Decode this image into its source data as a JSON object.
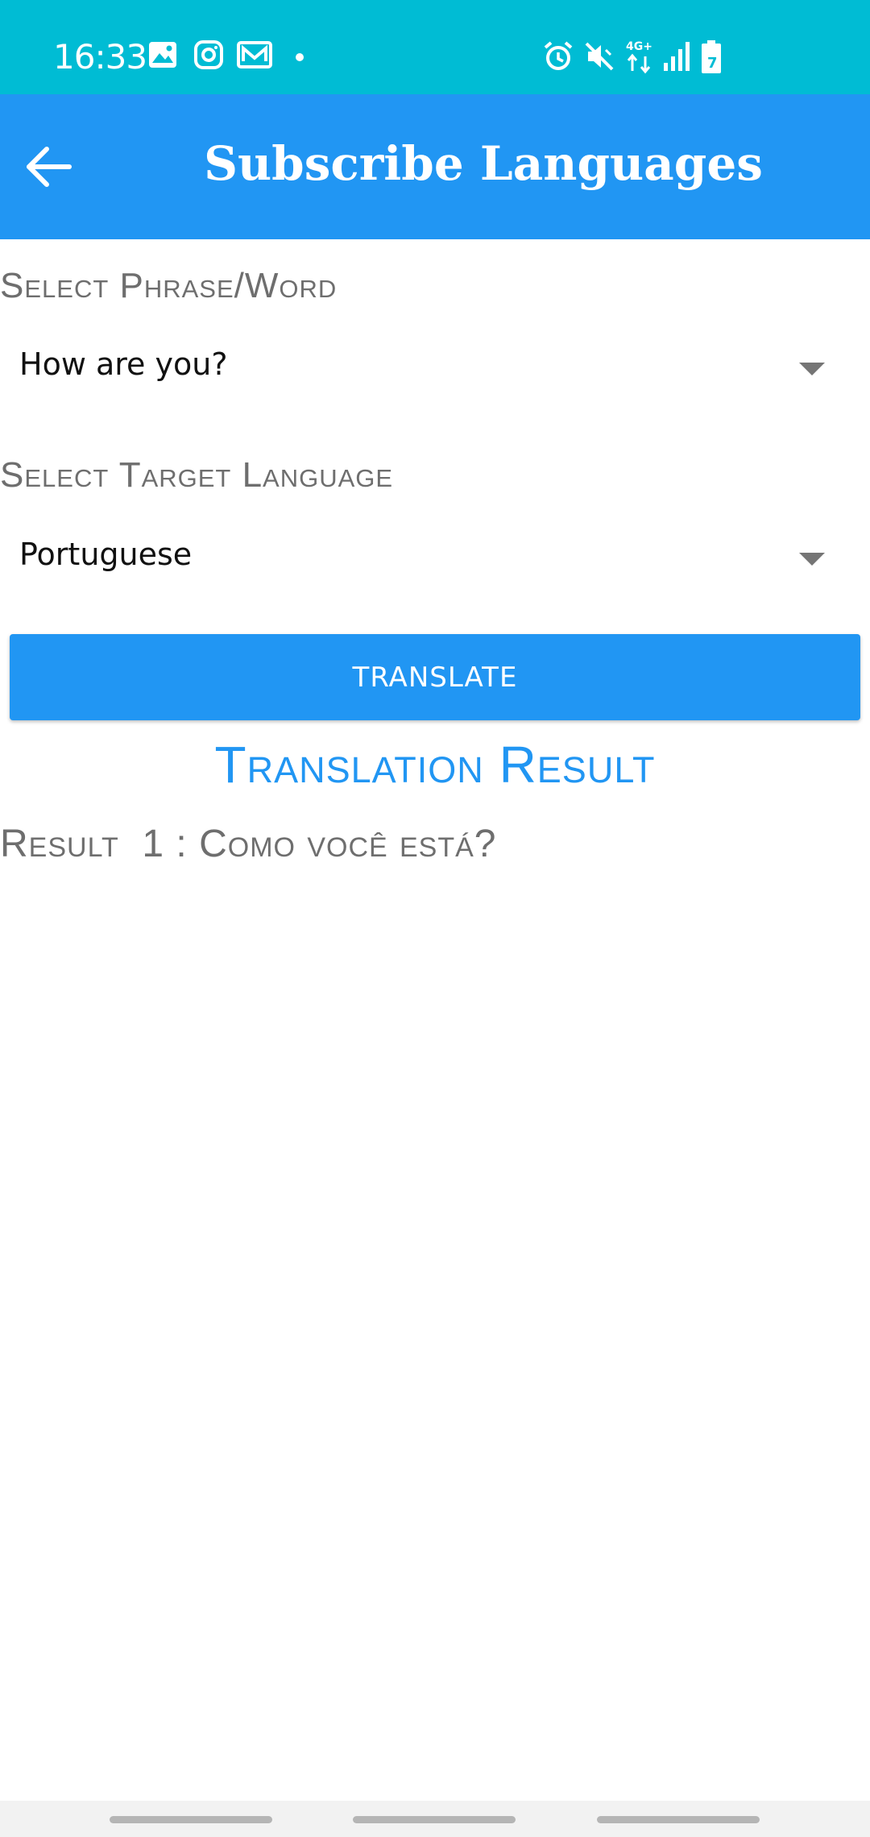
{
  "status_bar": {
    "time": "16:33",
    "left_icons": [
      "gallery-icon",
      "instagram-icon",
      "mail-icon",
      "dot-icon"
    ],
    "right_icons": [
      "alarm-icon",
      "vibrate-mute-icon",
      "network-4g-icon",
      "signal-icon",
      "battery-icon"
    ],
    "network_label": "4G+",
    "battery_level": "7"
  },
  "app_bar": {
    "title": "Subscribe Languages",
    "back_icon": "arrow-back-icon"
  },
  "form": {
    "phrase_label": "Select Phrase/Word",
    "phrase_value": "How are you?",
    "language_label": "Select Target Language",
    "language_value": "Portuguese",
    "translate_button": "TRANSLATE"
  },
  "result": {
    "title": "Translation Result",
    "line": "Result  1 : Como você está?"
  },
  "colors": {
    "status_bar": "#00bcd4",
    "app_bar": "#2196f3",
    "accent": "#2196f3",
    "label_gray": "#6e6e6e"
  }
}
